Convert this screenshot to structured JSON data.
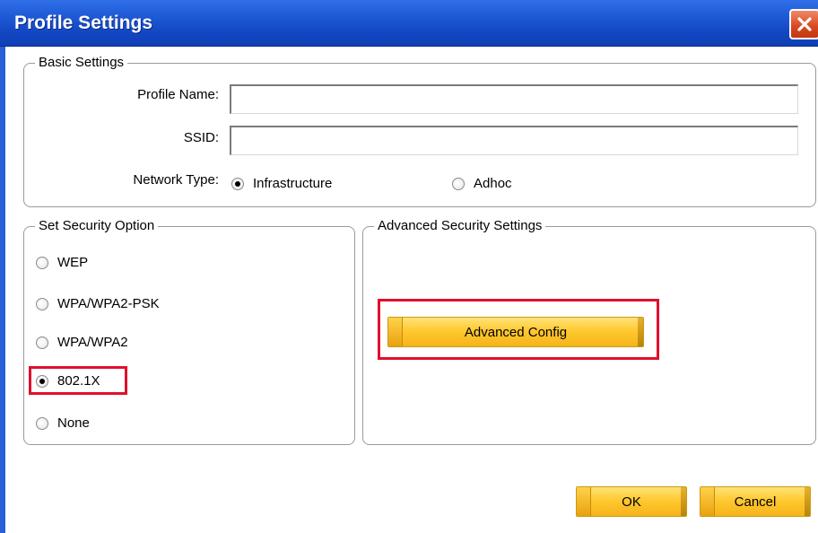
{
  "window": {
    "title": "Profile Settings",
    "close_icon": "close-icon",
    "accent_color": "#1f5ad6"
  },
  "basic_settings": {
    "legend": "Basic Settings",
    "profile_name": {
      "label": "Profile Name:",
      "value": ""
    },
    "ssid": {
      "label": "SSID:",
      "value": ""
    },
    "network_type": {
      "label": "Network Type:",
      "options": [
        "Infrastructure",
        "Adhoc"
      ],
      "selected": "Infrastructure"
    }
  },
  "security_option": {
    "legend": "Set Security Option",
    "options": [
      "WEP",
      "WPA/WPA2-PSK",
      "WPA/WPA2",
      "802.1X",
      "None"
    ],
    "selected": "802.1X"
  },
  "advanced_security": {
    "legend": "Advanced Security Settings",
    "button_label": "Advanced Config"
  },
  "footer": {
    "ok_label": "OK",
    "cancel_label": "Cancel"
  },
  "highlight_color": "#e0102a",
  "button_color": "#ffc930"
}
